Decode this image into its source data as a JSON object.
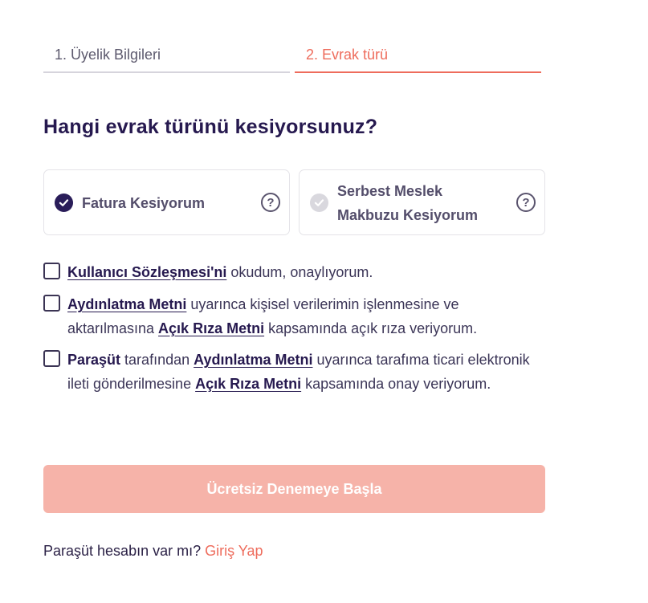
{
  "steps": [
    {
      "label": "1. Üyelik Bilgileri"
    },
    {
      "label": "2. Evrak türü"
    }
  ],
  "title": "Hangi evrak türünü kesiyorsunuz?",
  "options": [
    {
      "label": "Fatura Kesiyorum",
      "selected": true,
      "help_icon": "?"
    },
    {
      "label": "Serbest Meslek Makbuzu Kesiyorum",
      "selected": false,
      "help_icon": "?"
    }
  ],
  "consents": [
    {
      "link1": "Kullanıcı Sözleşmesi'ni",
      "text1": " okudum, onaylıyorum."
    },
    {
      "link1": "Aydınlatma Metni",
      "text1": " uyarınca kişisel verilerimin işlenmesine ve aktarılmasına ",
      "link2": "Açık Rıza Metni",
      "text2": " kapsamında açık rıza veriyorum."
    },
    {
      "brand": "Paraşüt",
      "text0": " tarafından ",
      "link1": "Aydınlatma Metni",
      "text1": " uyarınca tarafıma ticari elektronik ileti gönderilmesine ",
      "link2": "Açık Rıza Metni",
      "text2": " kapsamında onay veriyorum."
    }
  ],
  "cta": {
    "label": "Ücretsiz Denemeye Başla"
  },
  "footer": {
    "question": "Paraşüt hesabın var mı? ",
    "link": "Giriş Yap"
  },
  "colors": {
    "accent": "#ee6c5c",
    "primary": "#26194f",
    "cta_disabled": "#f6b3a9"
  }
}
